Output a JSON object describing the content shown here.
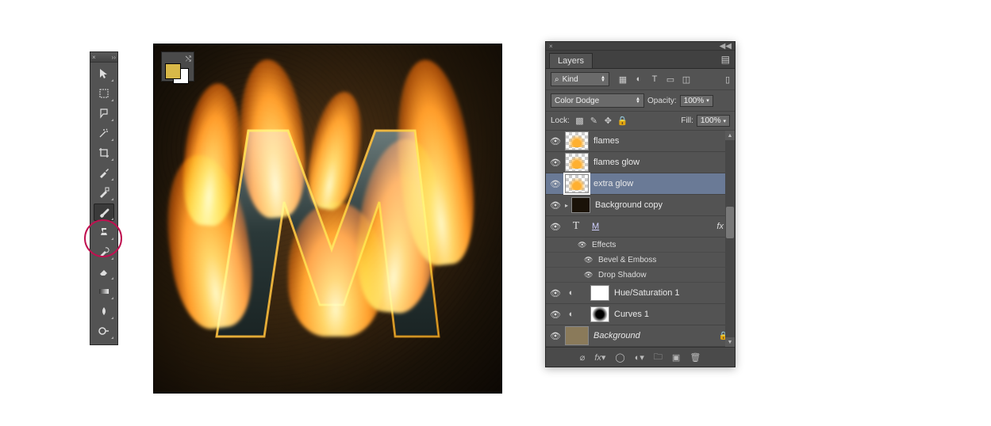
{
  "toolbar": {
    "tools": [
      {
        "name": "move-tool"
      },
      {
        "name": "marquee-tool"
      },
      {
        "name": "lasso-tool"
      },
      {
        "name": "magic-wand-tool"
      },
      {
        "name": "crop-tool"
      },
      {
        "name": "eyedropper-tool"
      },
      {
        "name": "healing-brush-tool"
      },
      {
        "name": "brush-tool"
      },
      {
        "name": "clone-stamp-tool"
      },
      {
        "name": "history-brush-tool"
      },
      {
        "name": "eraser-tool"
      },
      {
        "name": "gradient-tool"
      },
      {
        "name": "smudge-tool"
      },
      {
        "name": "dodge-tool"
      }
    ],
    "highlighted_tool": "brush-tool"
  },
  "canvas": {
    "foreground_color": "#d8b848",
    "background_color": "#ffffff",
    "letter": "M"
  },
  "layers_panel": {
    "tab_label": "Layers",
    "filter_kind": "Kind",
    "blend_mode": "Color Dodge",
    "opacity_label": "Opacity:",
    "opacity_value": "100%",
    "lock_label": "Lock:",
    "fill_label": "Fill:",
    "fill_value": "100%",
    "layers": [
      {
        "name": "flames",
        "thumb": "checker-flame"
      },
      {
        "name": "flames glow",
        "thumb": "checker-flame"
      },
      {
        "name": "extra glow",
        "thumb": "checker-flame",
        "selected": true
      },
      {
        "name": "Background copy",
        "thumb": "dark",
        "group": true
      },
      {
        "name": "M",
        "type": "text",
        "fx": true
      },
      {
        "effects_label": "Effects"
      },
      {
        "effect": "Bevel & Emboss"
      },
      {
        "effect": "Drop Shadow"
      },
      {
        "name": "Hue/Saturation 1",
        "adj": true,
        "mask": "white"
      },
      {
        "name": "Curves 1",
        "adj": true,
        "mask": "radial"
      },
      {
        "name": "Background",
        "thumb": "bgtex",
        "locked": true,
        "italic": true
      }
    ]
  }
}
